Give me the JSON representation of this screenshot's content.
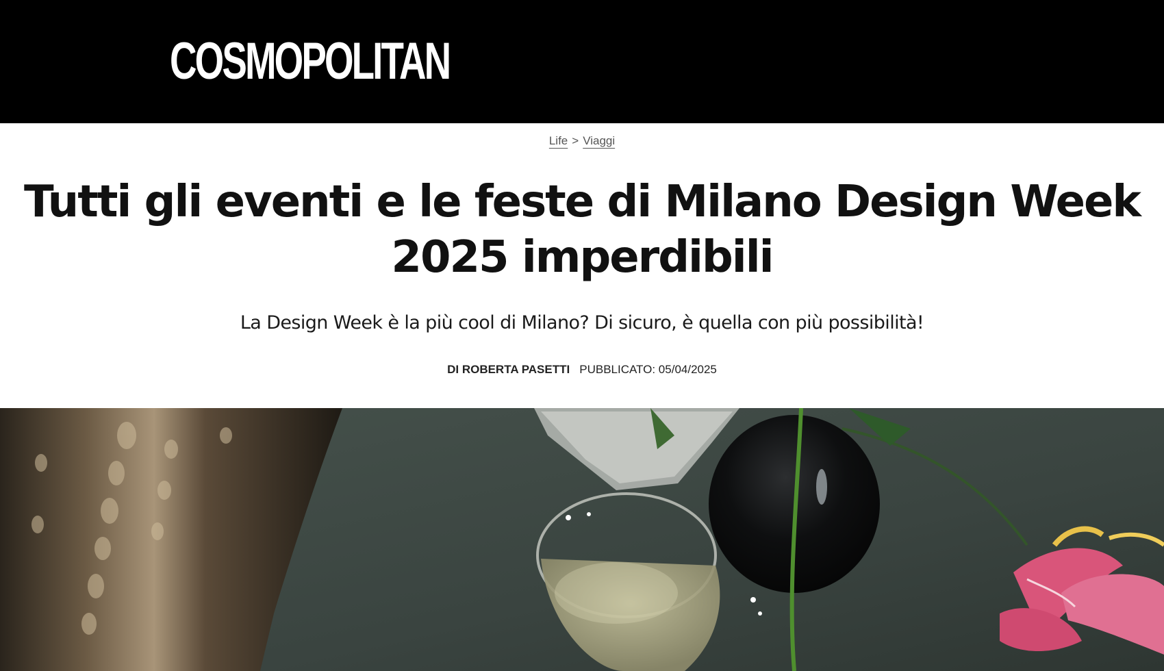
{
  "header": {
    "logo_text": "COSMOPOLITAN"
  },
  "breadcrumb": {
    "items": [
      "Life",
      "Viaggi"
    ],
    "separator": ">"
  },
  "article": {
    "title": "Tutti gli eventi e le feste di Milano Design Week 2025 imperdibili",
    "subtitle": "La Design Week è la più cool di Milano? Di sicuro, è quella con più possibilità!",
    "author": "DI ROBERTA PASETTI",
    "published": "PUBBLICATO: 05/04/2025"
  },
  "hero_image": {
    "depicts": "still life with hammered metal vase, cocktail glass, black vase with flower stem and pink lily"
  },
  "colors": {
    "masthead_bg": "#000000",
    "logo": "#ffffff",
    "text": "#111111",
    "breadcrumb": "#555555"
  }
}
